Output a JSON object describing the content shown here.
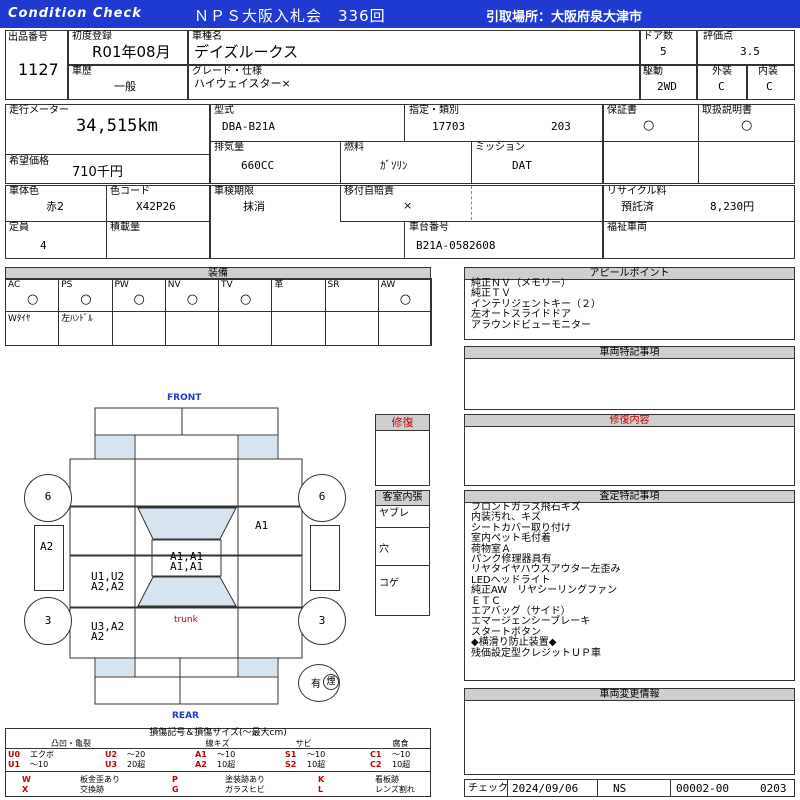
{
  "header": {
    "title_left": "Condition Check",
    "title_center": "ＮＰＳ大阪入札会　336回",
    "pickup": "引取場所：大阪府泉大津市"
  },
  "labels": {
    "lot_no": "出品番号",
    "first_reg": "初度登録",
    "car_name": "車種名",
    "doors": "ドア数",
    "score": "評価点",
    "history": "車歴",
    "grade": "グレード・仕様",
    "drive": "駆動",
    "exterior": "外装",
    "interior": "内装",
    "mileage": "走行メーター",
    "model": "型式",
    "designation": "指定・類別",
    "warranty": "保証書",
    "manual": "取扱説明書",
    "desired_price": "希望価格",
    "displacement": "排気量",
    "fuel": "燃料",
    "transmission": "ミッション",
    "color": "車体色",
    "color_code": "色コード",
    "inspection": "車検期限",
    "liability": "移付自賠責",
    "recycle": "リサイクル料",
    "capacity": "定員",
    "load": "積載量",
    "chassis": "車台番号",
    "welfare": "福祉車両"
  },
  "values": {
    "lot_no": "1127",
    "first_reg": "R01年08月",
    "car_name": "デイズルークス",
    "doors": "5",
    "score": "3.5",
    "history": "一般",
    "grade": "ハイウェイスター×",
    "drive": "2WD",
    "exterior": "C",
    "interior": "C",
    "mileage": "34,515km",
    "model": "DBA-B21A",
    "designation_1": "17703",
    "designation_2": "203",
    "warranty": "○",
    "manual": "○",
    "desired_price": "710千円",
    "displacement": "660CC",
    "fuel": "ｶﾞｿﾘﾝ",
    "transmission": "DAT",
    "color": "赤2",
    "color_code": "X42P26",
    "inspection": "抹消",
    "liability": "×",
    "recycle_status": "預託済",
    "recycle_amount": "8,230円",
    "capacity": "4",
    "chassis": "B21A-0582608"
  },
  "equipment": {
    "title": "装備",
    "items": [
      {
        "label": "AC",
        "mark": "○"
      },
      {
        "label": "PS",
        "mark": "○"
      },
      {
        "label": "PW",
        "mark": "○"
      },
      {
        "label": "NV",
        "mark": "○"
      },
      {
        "label": "TV",
        "mark": "○"
      },
      {
        "label": "革",
        "mark": ""
      },
      {
        "label": "SR",
        "mark": ""
      },
      {
        "label": "AW",
        "mark": "○"
      }
    ],
    "extra": [
      "Wﾀｲﾔ",
      "左ﾊﾝﾄﾞﾙ"
    ]
  },
  "appeal": {
    "title": "アピールポイント",
    "text": "純正ＮＶ（メモリー）\n純正ＴＶ\nインテリジェントキー（２）\n左オートスライドドア\nアラウンドビューモニター"
  },
  "special": {
    "title": "車両特記事項"
  },
  "repair_box": {
    "title": "修復"
  },
  "repair_detail": {
    "title": "修復内容"
  },
  "inspection_notes": {
    "title": "査定特記事項",
    "text": "フロントガラス飛石キズ\n内装汚れ、キズ\nシートカバー取り付け\n室内ペット毛付着\n荷物室Ａ\nパンク修理器具有\nリヤタイヤハウスアウター左歪み\nLEDヘッドライト\n純正AW　リヤシーリングファン\nＥＴＣ\nエアバッグ（サイド）\nエマージェンシーブレーキ\nスタートボタン\n◆横滑り防止装置◆\n残価設定型クレジットＵＰ車"
  },
  "cabin": {
    "title": "客室内張",
    "rows": [
      "ヤブレ",
      "穴",
      "コゲ"
    ]
  },
  "change_info": {
    "title": "車両変更情報"
  },
  "diagram": {
    "front": "FRONT",
    "rear": "REAR",
    "trunk": "trunk",
    "tires": [
      "6",
      "6",
      "3",
      "3"
    ],
    "marks": {
      "roof_1": "A1,A1",
      "roof_2": "A1,A1",
      "right_front": "A1",
      "left_front": "A2",
      "left_mid_1": "U1,U2",
      "left_mid_2": "A2,A2",
      "left_rear_1": "U3,A2",
      "left_rear_2": "A2"
    },
    "smoke_label": "有",
    "smoke_icon": "煙"
  },
  "legend": {
    "title": "損傷記号＆損傷サイズ(～最大cm)",
    "groups": [
      "凸凹・亀裂",
      "線キズ",
      "サビ",
      "腐食"
    ],
    "cells": [
      [
        "U0",
        "エクボ",
        "U2",
        "～20",
        "A1",
        "～10",
        "S1",
        "～10",
        "C1",
        "～10"
      ],
      [
        "U1",
        "～10",
        "U3",
        "20超",
        "A2",
        "10超",
        "S2",
        "10超",
        "C2",
        "10超"
      ]
    ],
    "symbols": [
      [
        "W",
        "板金歪あり",
        "P",
        "塗装跡あり",
        "K",
        "看板跡"
      ],
      [
        "X",
        "交換跡",
        "G",
        "ガラスヒビ",
        "L",
        "レンズ割れ"
      ]
    ]
  },
  "footer": {
    "check_label": "チェック",
    "date": "2024/09/06",
    "inspector": "NS",
    "code_1": "00002-00",
    "code_2": "0203"
  }
}
